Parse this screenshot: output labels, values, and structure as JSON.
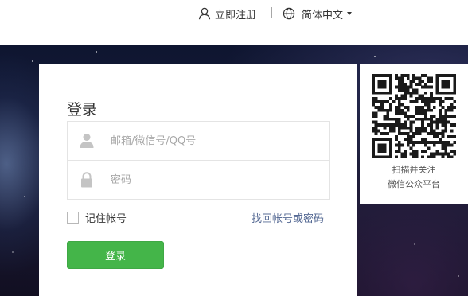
{
  "header": {
    "register_label": "立即注册",
    "separator": "|",
    "language_label": "简体中文"
  },
  "login": {
    "title": "登录",
    "account_placeholder": "邮箱/微信号/QQ号",
    "password_placeholder": "密码",
    "remember_label": "记住帐号",
    "forgot_label": "找回帐号或密码",
    "submit_label": "登录"
  },
  "qr": {
    "line1": "扫描并关注",
    "line2": "微信公众平台"
  },
  "colors": {
    "accent_green": "#44b549",
    "link_blue": "#576b95",
    "text": "#353535",
    "placeholder": "#a8a8a8"
  },
  "icons": {
    "register": "person-icon",
    "language": "globe-icon",
    "account": "user-icon",
    "password": "lock-icon",
    "qr": "qr-code"
  }
}
